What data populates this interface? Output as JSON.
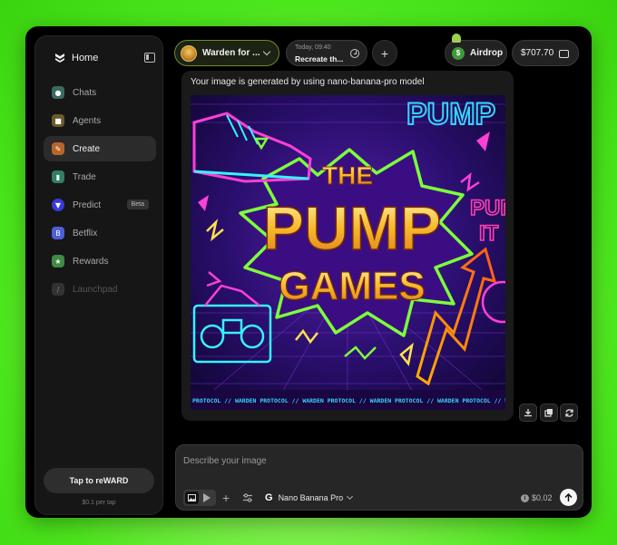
{
  "sidebar": {
    "home_label": "Home",
    "items": [
      {
        "label": "Chats",
        "icon": "chat-icon",
        "color": "#3a6b63"
      },
      {
        "label": "Agents",
        "icon": "agents-icon",
        "color": "#6b5a2a"
      },
      {
        "label": "Create",
        "icon": "pencil-icon",
        "color": "#b8652a"
      },
      {
        "label": "Trade",
        "icon": "trade-icon",
        "color": "#2f7f64"
      },
      {
        "label": "Predict",
        "icon": "predict-icon",
        "color": "#3a3ad9",
        "badge": "Beta"
      },
      {
        "label": "Betflix",
        "icon": "betflix-icon",
        "color": "#4b5fd6"
      },
      {
        "label": "Rewards",
        "icon": "rewards-icon",
        "color": "#3e8b43"
      },
      {
        "label": "Launchpad",
        "icon": "launchpad-icon",
        "color": "#555555"
      }
    ],
    "tap_button": "Tap to reWARD",
    "tap_sub": "$0.1 per tap"
  },
  "header": {
    "agent_name": "Warden for ...",
    "recent_time": "Today, 09:40",
    "recent_title": "Recreate th...",
    "airdrop_label": "Airdrop",
    "balance": "$707.70"
  },
  "message": {
    "text": "Your image is generated by using nano-banana-pro model",
    "image": {
      "title_line1": "THE",
      "title_line2": "PUMP",
      "title_line3": "GAMES",
      "corner_text": "PUMP",
      "side_text_1": "PUM",
      "side_text_2": "IT",
      "footer_text": "PROTOCOL // WARDEN PROTOCOL // WARDEN PROTOCOL // WARDEN PROTOCOL // WARDEN PROTOCOL // WARDEN PROTOCOL // WARDEN"
    }
  },
  "composer": {
    "placeholder": "Describe your image",
    "model_label": "Nano Banana Pro",
    "cost": "$0.02"
  }
}
